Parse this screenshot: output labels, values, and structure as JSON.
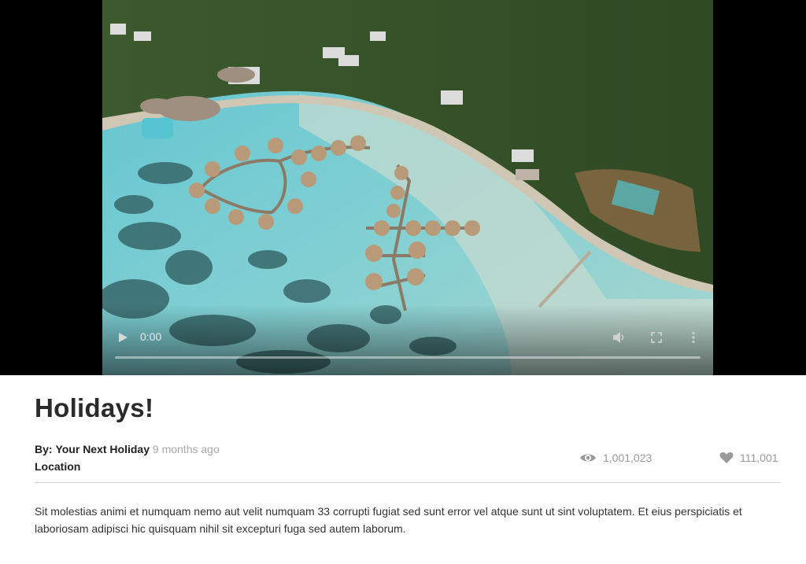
{
  "video": {
    "current_time": "0:00",
    "progress": 0
  },
  "post": {
    "title": "Holidays!",
    "author_prefix": "By:",
    "author": "Your Next Holiday",
    "posted_ago": "9 months ago",
    "location_label": "Location",
    "views": "1,001,023",
    "likes": "111,001",
    "description": "Sit molestias animi et numquam nemo aut velit numquam 33 corrupti fugiat sed sunt error vel atque sunt ut sint voluptatem. Et eius perspiciatis et laboriosam adipisci hic quisquam nihil sit excepturi fuga sed autem laborum."
  },
  "icons": {
    "play": "play-icon",
    "volume": "volume-icon",
    "fullscreen": "fullscreen-icon",
    "more": "more-options-icon",
    "views": "eye-icon",
    "likes": "heart-icon"
  },
  "colors": {
    "muted_text": "#9a9a9a",
    "divider": "#d6d6d6",
    "title": "#2a2a2a"
  }
}
